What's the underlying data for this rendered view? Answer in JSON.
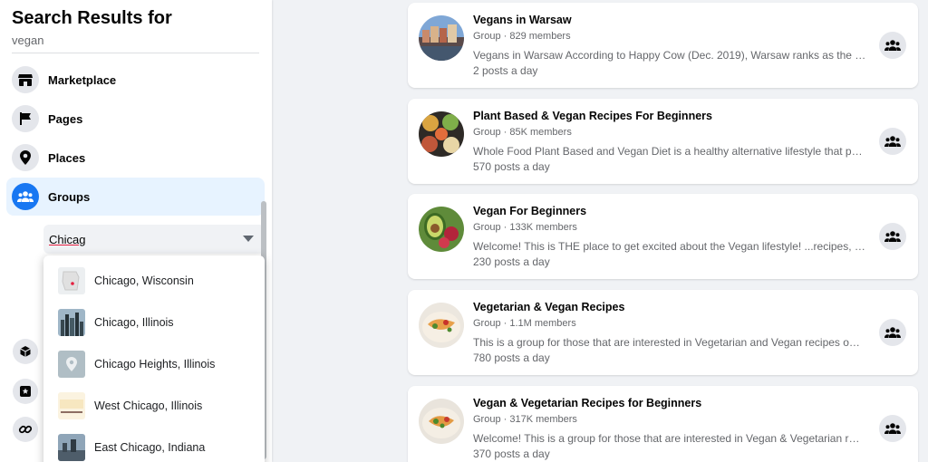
{
  "sidebar": {
    "title": "Search Results for",
    "query": "vegan",
    "nav": [
      {
        "label": "Marketplace",
        "icon": "marketplace-icon"
      },
      {
        "label": "Pages",
        "icon": "flag-icon"
      },
      {
        "label": "Places",
        "icon": "location-pin-icon"
      },
      {
        "label": "Groups",
        "icon": "groups-icon",
        "active": true
      }
    ],
    "location_filter": {
      "value": "Chicag"
    },
    "suggestions": [
      {
        "label": "Chicago, Wisconsin"
      },
      {
        "label": "Chicago, Illinois"
      },
      {
        "label": "Chicago Heights, Illinois"
      },
      {
        "label": "West Chicago, Illinois"
      },
      {
        "label": "East Chicago, Indiana"
      }
    ],
    "collapsed_icons": [
      "cube-icon",
      "star-box-icon",
      "link-icon"
    ]
  },
  "results": [
    {
      "name": "Vegans in Warsaw",
      "meta": "Group · 829 members",
      "description": "Vegans in Warsaw According to Happy Cow (Dec. 2019), Warsaw ranks as the …",
      "activity": "2 posts a day"
    },
    {
      "name": "Plant Based & Vegan Recipes For Beginners",
      "meta": "Group · 85K members",
      "description": "Whole Food Plant Based and Vegan Diet is a healthy alternative lifestyle that p…",
      "activity": "570 posts a day"
    },
    {
      "name": "Vegan For Beginners",
      "meta": "Group · 133K members",
      "description": "Welcome! This is THE place to get excited about the Vegan lifestyle! ...recipes, …",
      "activity": "230 posts a day"
    },
    {
      "name": "Vegetarian & Vegan Recipes",
      "meta": "Group · 1.1M members",
      "description": "This is a group for those that are interested in Vegetarian and Vegan recipes o…",
      "activity": "780 posts a day"
    },
    {
      "name": "Vegan & Vegetarian Recipes for Beginners",
      "meta": "Group · 317K members",
      "description": "Welcome! This is a group for those that are interested in Vegan & Vegetarian r…",
      "activity": "370 posts a day"
    }
  ],
  "colors": {
    "accent": "#1877f2",
    "active_bg": "#e7f3ff",
    "page_bg": "#f0f2f5"
  }
}
